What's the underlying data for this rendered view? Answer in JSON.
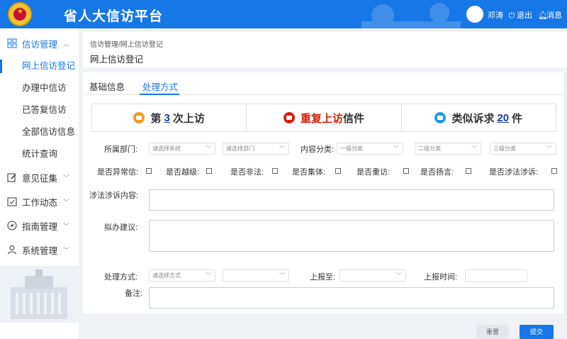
{
  "header": {
    "title": "省人大信访平台",
    "username": "邓涛",
    "logout_label": "退出",
    "messages_label": "消息",
    "color": "#1677e6"
  },
  "sidebar": {
    "groups": [
      {
        "label": "信访管理",
        "icon": "grid-icon",
        "expanded": true,
        "items": [
          "网上信访登记",
          "办理中信访",
          "已答复信访",
          "全部信访信息",
          "统计查询"
        ]
      },
      {
        "label": "意见征集",
        "icon": "edit-icon"
      },
      {
        "label": "工作动态",
        "icon": "calendar-icon"
      },
      {
        "label": "指南管理",
        "icon": "compass-icon"
      },
      {
        "label": "系统管理",
        "icon": "user-icon"
      }
    ]
  },
  "breadcrumb": "信访管理/网上信访登记",
  "page_title": "网上信访登记",
  "tabs": [
    "基础信息",
    "处理方式"
  ],
  "active_tab": "处理方式",
  "stats": {
    "visit_prefix": "第",
    "visit_count": "3",
    "visit_suffix": "次上访",
    "repeat_red": "重复上访",
    "repeat_rest": "信件",
    "similar_prefix": "类似诉求",
    "similar_count": "20",
    "similar_suffix": "件"
  },
  "form": {
    "dept_label": "所属部门:",
    "system_placeholder": "请选择系统",
    "dept_placeholder": "请选择部门",
    "category_label": "内容分类:",
    "cat1_placeholder": "一级分类",
    "cat2_placeholder": "二级分类",
    "cat3_placeholder": "三级分类",
    "checks": [
      "是否异常信:",
      "是否越级:",
      "是否非法:",
      "是否集体:",
      "是否重访:",
      "是否扬言:",
      "是否涉法涉诉:"
    ],
    "legal_content_label": "涉法涉诉内容:",
    "suggestion_label": "拟办建议:",
    "method_label": "处理方式:",
    "method_placeholder": "请选择方式",
    "report_to_label": "上报至:",
    "report_time_label": "上报时间:",
    "remark_label": "备注:"
  },
  "buttons": {
    "reset": "重置",
    "submit": "提交"
  }
}
